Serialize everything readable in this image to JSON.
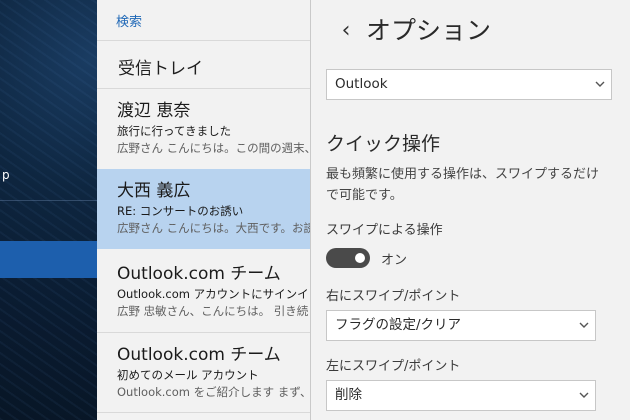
{
  "nav": {
    "item_p_label": "p"
  },
  "list": {
    "search_label": "検索",
    "inbox_title": "受信トレイ",
    "mails": [
      {
        "from": "渡辺 恵奈",
        "subject": "旅行に行ってきました",
        "preview": "広野さん こんにちは。この間の週末、",
        "selected": false
      },
      {
        "from": "大西 義広",
        "subject": "RE: コンサートのお誘い",
        "preview": "広野さん こんにちは。大西です。お誘い",
        "selected": true
      },
      {
        "from": "Outlook.com チーム",
        "subject": "Outlook.com アカウントにサインインし",
        "preview": "広野 忠敏さん、こんにちは。 引き続き",
        "selected": false
      },
      {
        "from": "Outlook.com チーム",
        "subject": "初めてのメール アカウント",
        "preview": "Outlook.com をご紹介します まず、メ",
        "selected": false
      }
    ]
  },
  "panel": {
    "back_icon": "chevron-left",
    "title": "オプション",
    "account_select": "Outlook",
    "section_title": "クイック操作",
    "description": "最も頻繁に使用する操作は、スワイプするだけで可能です。",
    "swipe_label": "スワイプによる操作",
    "toggle_state": "オン",
    "toggle_on": true,
    "swipe_right_label": "右にスワイプ/ポイント",
    "swipe_right_value": "フラグの設定/クリア",
    "swipe_left_label": "左にスワイプ/ポイント",
    "swipe_left_value": "削除"
  },
  "colors": {
    "accent": "#1e67b6",
    "selected_row": "#b8d3ef",
    "nav_selected": "#1d5fad",
    "toggle_track": "#4a4a4a"
  }
}
